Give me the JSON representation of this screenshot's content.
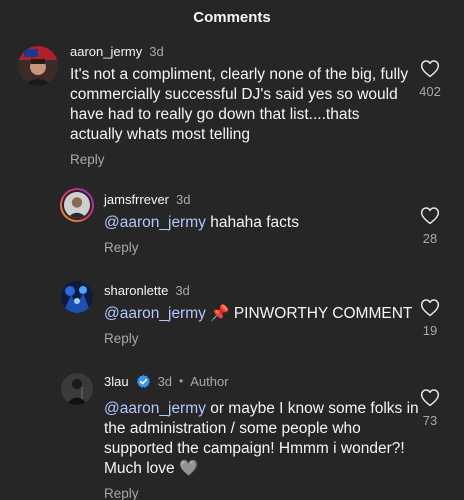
{
  "header": {
    "title": "Comments"
  },
  "comments": [
    {
      "username": "aaron_jermy",
      "time": "3d",
      "text": "It's not a compliment, clearly none of the big, fully commercially successful DJ's said yes so would have had to really go down that list....thats actually whats most telling",
      "reply_label": "Reply",
      "likes": "402"
    },
    {
      "username": "jamsfrrever",
      "time": "3d",
      "mention": "@aaron_jermy",
      "text": "hahaha facts",
      "reply_label": "Reply",
      "likes": "28"
    },
    {
      "username": "sharonlette",
      "time": "3d",
      "mention": "@aaron_jermy",
      "emoji": "📌",
      "text": "PINWORTHY COMMENT",
      "reply_label": "Reply",
      "likes": "19"
    },
    {
      "username": "3lau",
      "verified_icon": "verified-badge-icon",
      "time": "3d",
      "author_label": "Author",
      "mention": "@aaron_jermy",
      "text": "or maybe I know some folks in the administration / some people who supported the campaign! Hmmm i wonder?! Much love",
      "emoji": "🩶",
      "reply_label": "Reply",
      "likes": "73"
    }
  ],
  "colors": {
    "background": "#262626",
    "mention": "#b3c7ff",
    "secondary_text": "#a8a8a8",
    "verified": "#3897f0"
  }
}
